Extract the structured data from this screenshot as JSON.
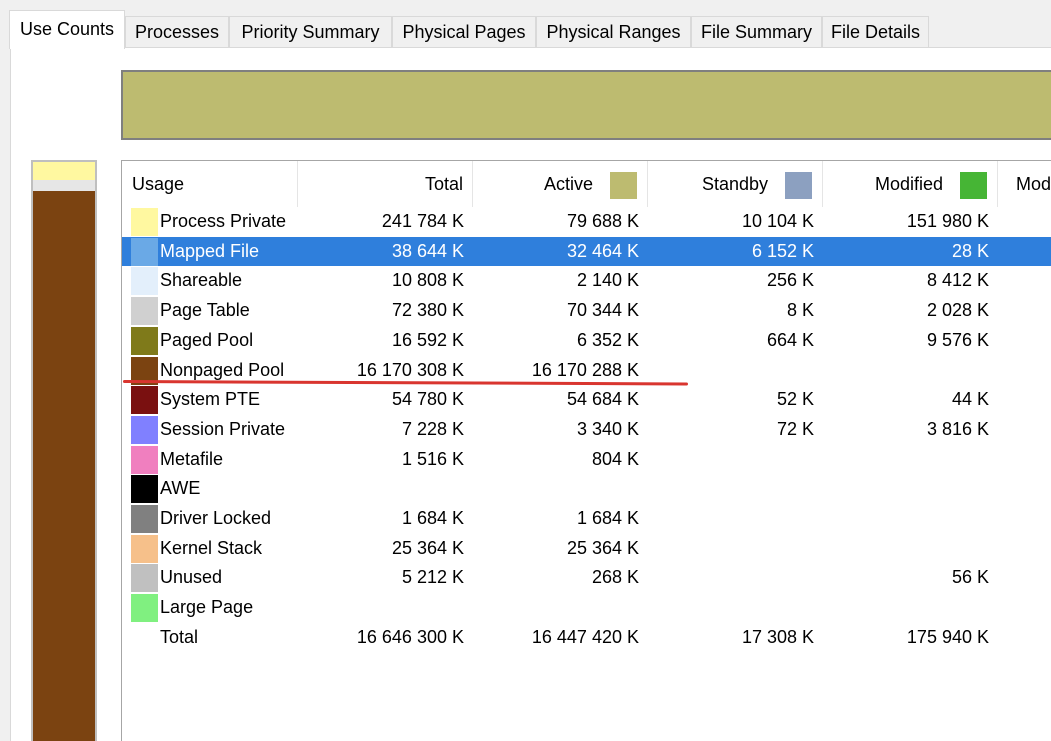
{
  "tabs": [
    {
      "label": "Use Counts",
      "active": true
    },
    {
      "label": "Processes"
    },
    {
      "label": "Priority Summary"
    },
    {
      "label": "Physical Pages"
    },
    {
      "label": "Physical Ranges"
    },
    {
      "label": "File Summary"
    },
    {
      "label": "File Details"
    }
  ],
  "columns": {
    "usage": "Usage",
    "total": "Total",
    "active": "Active",
    "standby": "Standby",
    "modified": "Modified",
    "modified_extra": "Mod"
  },
  "column_colors": {
    "active": "#bdbb70",
    "standby": "#8ca0c0",
    "modified": "#46b535"
  },
  "rows": [
    {
      "name": "Process Private",
      "color": "#fff8a0",
      "total": "241 784 K",
      "active": "79 688 K",
      "standby": "10 104 K",
      "modified": "151 980 K"
    },
    {
      "name": "Mapped File",
      "color": "#6aa9e6",
      "total": "38 644 K",
      "active": "32 464 K",
      "standby": "6 152 K",
      "modified": "28 K",
      "selected": true
    },
    {
      "name": "Shareable",
      "color": "#e3effb",
      "total": "10 808 K",
      "active": "2 140 K",
      "standby": "256 K",
      "modified": "8 412 K"
    },
    {
      "name": "Page Table",
      "color": "#d0d0d0",
      "total": "72 380 K",
      "active": "70 344 K",
      "standby": "8 K",
      "modified": "2 028 K"
    },
    {
      "name": "Paged Pool",
      "color": "#7f7a1a",
      "total": "16 592 K",
      "active": "6 352 K",
      "standby": "664 K",
      "modified": "9 576 K"
    },
    {
      "name": "Nonpaged Pool",
      "color": "#7b4311",
      "total": "16 170 308 K",
      "active": "16 170 288 K",
      "standby": "",
      "modified": ""
    },
    {
      "name": "System PTE",
      "color": "#7a1010",
      "total": "54 780 K",
      "active": "54 684 K",
      "standby": "52 K",
      "modified": "44 K"
    },
    {
      "name": "Session Private",
      "color": "#8080ff",
      "total": "7 228 K",
      "active": "3 340 K",
      "standby": "72 K",
      "modified": "3 816 K"
    },
    {
      "name": "Metafile",
      "color": "#f07fbf",
      "total": "1 516 K",
      "active": "804 K",
      "standby": "",
      "modified": ""
    },
    {
      "name": "AWE",
      "color": "#000000",
      "total": "",
      "active": "",
      "standby": "",
      "modified": ""
    },
    {
      "name": "Driver Locked",
      "color": "#808080",
      "total": "1 684 K",
      "active": "1 684 K",
      "standby": "",
      "modified": ""
    },
    {
      "name": "Kernel Stack",
      "color": "#f6c08a",
      "total": "25 364 K",
      "active": "25 364 K",
      "standby": "",
      "modified": ""
    },
    {
      "name": "Unused",
      "color": "#c0c0c0",
      "total": "5 212 K",
      "active": "268 K",
      "standby": "",
      "modified": "56 K"
    },
    {
      "name": "Large Page",
      "color": "#80f080",
      "total": "",
      "active": "",
      "standby": "",
      "modified": ""
    },
    {
      "name": "Total",
      "color": "",
      "total": "16 646 300 K",
      "active": "16 447 420 K",
      "standby": "17 308 K",
      "modified": "175 940 K"
    }
  ],
  "gauge_colors": {
    "top": "#fff8a0",
    "second": "#e6e6e6",
    "fill": "#7b4311"
  },
  "bargraph_color": "#bdbb70",
  "annotation_color": "#d9352f"
}
